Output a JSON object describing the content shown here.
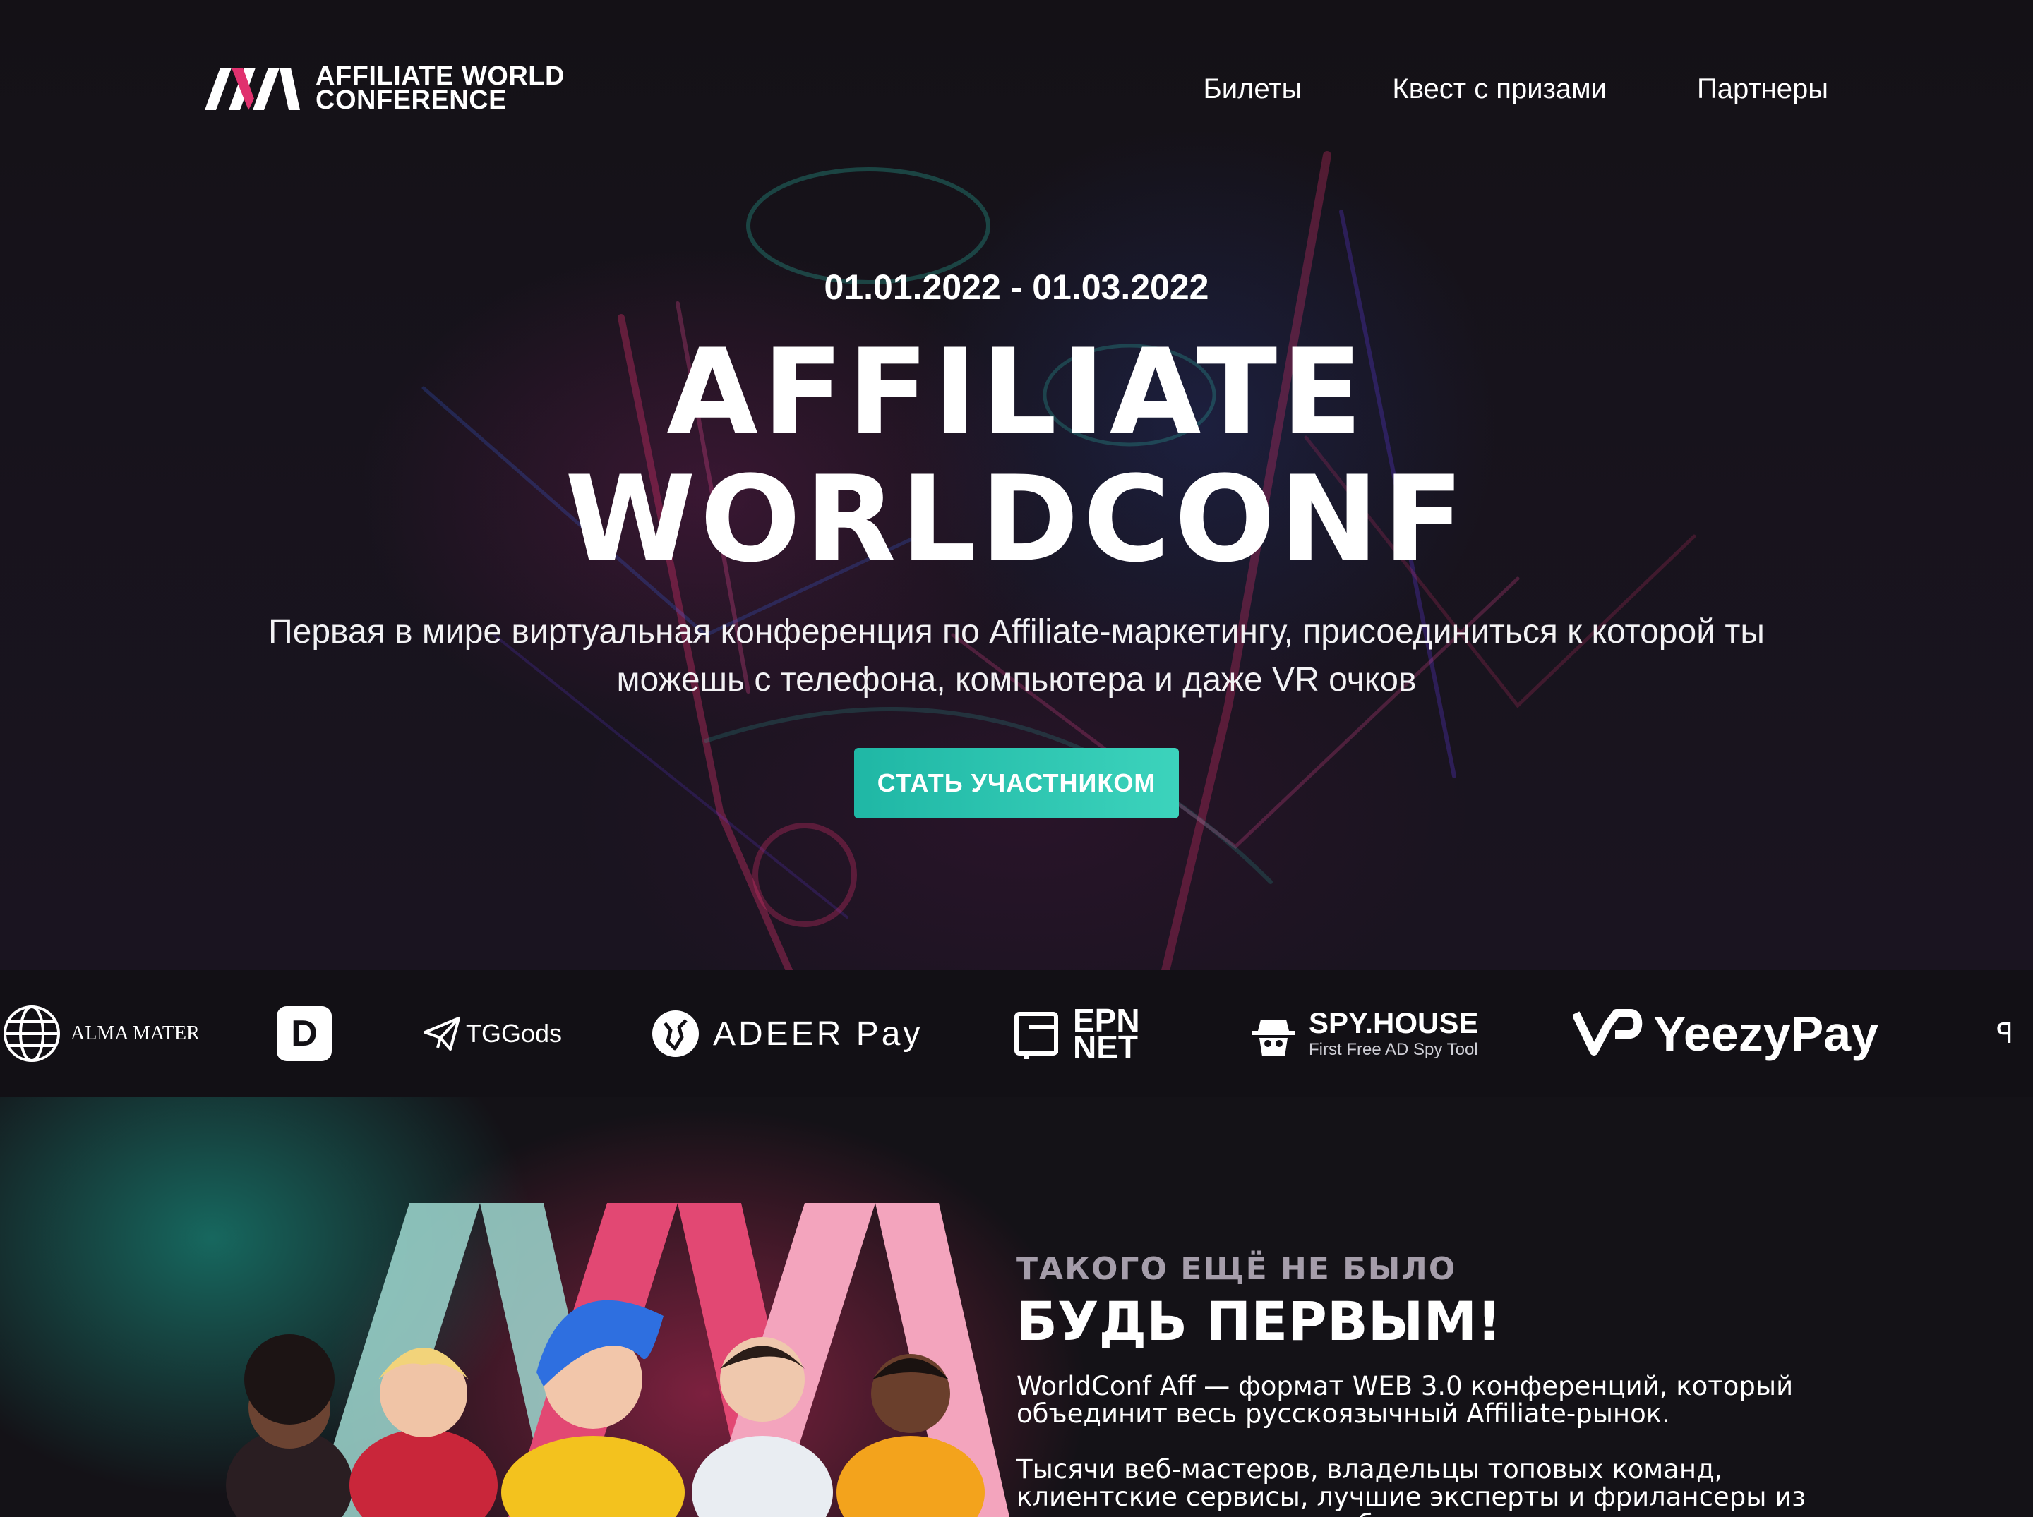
{
  "header": {
    "logo_line1": "AFFILIATE WORLD",
    "logo_line2": "CONFERENCE",
    "nav": [
      "Билеты",
      "Квест с призами",
      "Партнеры"
    ]
  },
  "hero": {
    "dates": "01.01.2022 - 01.03.2022",
    "title_line1": "AFFILIATE",
    "title_line2": "WORLDCONF",
    "description": "Первая в мире виртуальная конференция по Affiliate-маркетингу, присоединиться к которой ты можешь с телефона, компьютера и даже VR очков",
    "cta": "СТАТЬ УЧАСТНИКОМ"
  },
  "partners": [
    {
      "name": "ALMA MATER",
      "icon": "globe-icon"
    },
    {
      "name": "D",
      "icon": "d-logo-icon"
    },
    {
      "name": "TGGods",
      "icon": "paper-plane-icon"
    },
    {
      "name": "ADEER Pay",
      "icon": "deer-icon"
    },
    {
      "name": "EPN NET",
      "icon": "epn-logo-icon"
    },
    {
      "name": "SPY.HOUSE",
      "sub": "First Free AD Spy Tool",
      "icon": "spy-hat-icon"
    },
    {
      "name": "YeezyPay",
      "icon": "yeezypay-logo-icon"
    }
  ],
  "section2": {
    "eyebrow": "ТАКОГО ЕЩЁ НЕ БЫЛО",
    "title": "БУДЬ ПЕРВЫМ!",
    "paragraph1": "WorldConf Aff — формат WEB 3.0 конференций, который объединит весь русскоязычный Affiliate-рынок.",
    "paragraph2": "Тысячи веб-мастеров, владельцы топовых команд, клиентские сервисы, лучшие эксперты и фрилансеры из разных уголков света соберутся вместе."
  },
  "colors": {
    "background": "#141217",
    "accent_teal": "#2cc4b0",
    "logo_pink": "#e0316e",
    "logo_white": "#ffffff"
  }
}
